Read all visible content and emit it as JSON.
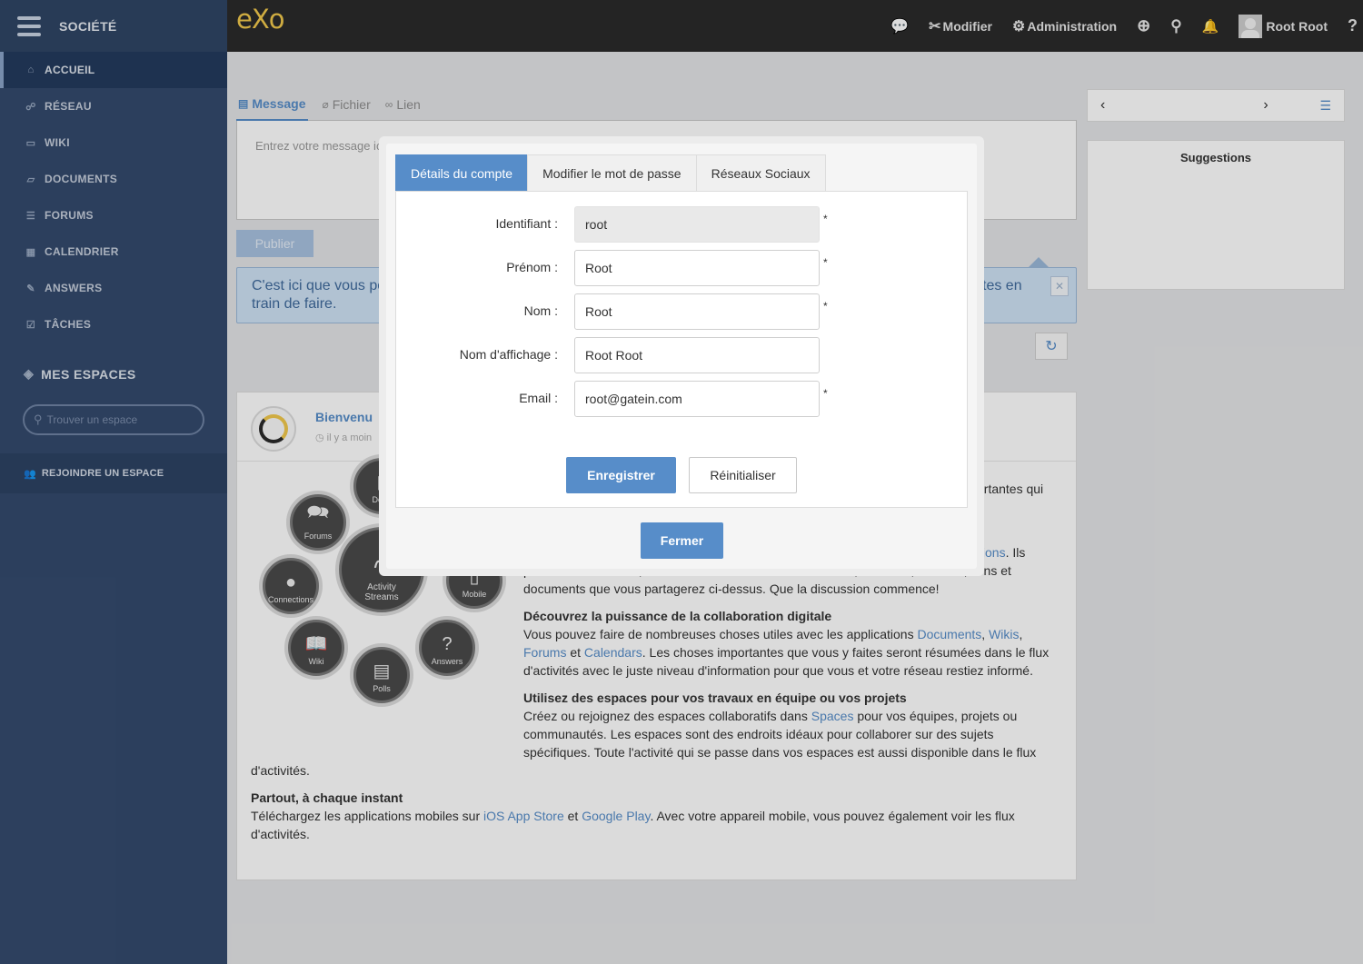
{
  "sidebar": {
    "title": "SOCIÉTÉ",
    "items": [
      {
        "label": "ACCUEIL"
      },
      {
        "label": "RÉSEAU"
      },
      {
        "label": "WIKI"
      },
      {
        "label": "DOCUMENTS"
      },
      {
        "label": "FORUMS"
      },
      {
        "label": "CALENDRIER"
      },
      {
        "label": "ANSWERS"
      },
      {
        "label": "TÂCHES"
      }
    ],
    "spaces_title": "MES ESPACES",
    "space_search_placeholder": "Trouver un espace",
    "join_label": "REJOINDRE UN ESPACE"
  },
  "topbar": {
    "logo": "eXo",
    "edit_label": "Modifier",
    "admin_label": "Administration",
    "user_name": "Root Root"
  },
  "composer": {
    "tabs": [
      {
        "label": "Message"
      },
      {
        "label": "Fichier"
      },
      {
        "label": "Lien"
      }
    ],
    "placeholder": "Entrez votre message ic",
    "publish_label": "Publier"
  },
  "info_bar": {
    "text_left": "C'est ici que vous po",
    "text_left_2": "train de faire.",
    "text_right": "tes en"
  },
  "activity": {
    "title": "Bienvenu",
    "time": "il y a moin",
    "intro_tail": "ortantes qui",
    "p1_tail": "tions",
    "p1_tail2": ". Ils",
    "p1_line2": "pourront vous suivre, commenter et aimer toutes vos idées, humeurs, activités, liens et",
    "p1_line3": "documents que vous partagerez ci-dessus. Que la discussion commence!",
    "h2": "Découvrez la puissance de la collaboration digitale",
    "p2_a": "Vous pouvez faire de nombreuses choses utiles avec les applications ",
    "p2_link1": "Documents",
    "p2_sep": ", ",
    "p2_link2": "Wikis",
    "p2_comma": ",",
    "p2_link3": "Forums",
    "p2_et": " et ",
    "p2_link4": "Calendars",
    "p2_b": ". Les choses importantes que vous y faites seront résumées dans le flux",
    "p2_c": "d'activités avec le juste niveau d'information pour que vous et votre réseau restiez informé.",
    "h3": "Utilisez des espaces pour vos travaux en équipe ou vos projets",
    "p3_a": "Créez ou rejoignez des espaces collaboratifs dans ",
    "p3_link": "Spaces",
    "p3_b": " pour vos équipes, projets ou",
    "p3_c": "communautés. Les espaces sont des endroits idéaux pour collaborer sur des sujets",
    "p3_d": "spécifiques. Toute l'activité qui se passe dans vos espaces est aussi disponible dans le flux",
    "p3_e": "d'activités.",
    "h4": "Partout, à chaque instant",
    "p4_a": "Téléchargez les applications mobiles sur ",
    "p4_link1": "iOS App Store",
    "p4_et": " et ",
    "p4_link2": "Google Play",
    "p4_b": ". Avec votre appareil mobile, vous pouvez également voir les flux",
    "p4_c": "d'activités.",
    "bubbles": {
      "forums": "Forums",
      "documents": "Docu",
      "connections": "Connections",
      "activity_1": "Activity",
      "activity_2": "Streams",
      "mobile": "Mobile",
      "wiki": "Wiki",
      "polls": "Polls",
      "answers": "Answers"
    }
  },
  "right": {
    "prev": "‹",
    "next": "›",
    "suggestions_title": "Suggestions"
  },
  "modal": {
    "tabs": [
      {
        "label": "Détails du compte"
      },
      {
        "label": "Modifier le mot de passe"
      },
      {
        "label": "Réseaux Sociaux"
      }
    ],
    "fields": [
      {
        "label": "Identifiant :",
        "value": "root",
        "required": "*"
      },
      {
        "label": "Prénom :",
        "value": "Root",
        "required": "*"
      },
      {
        "label": "Nom :",
        "value": "Root",
        "required": "*"
      },
      {
        "label": "Nom d'affichage :",
        "value": "Root Root",
        "required": ""
      },
      {
        "label": "Email :",
        "value": "root@gatein.com",
        "required": "*"
      }
    ],
    "save_label": "Enregistrer",
    "reset_label": "Réinitialiser",
    "close_label": "Fermer"
  }
}
